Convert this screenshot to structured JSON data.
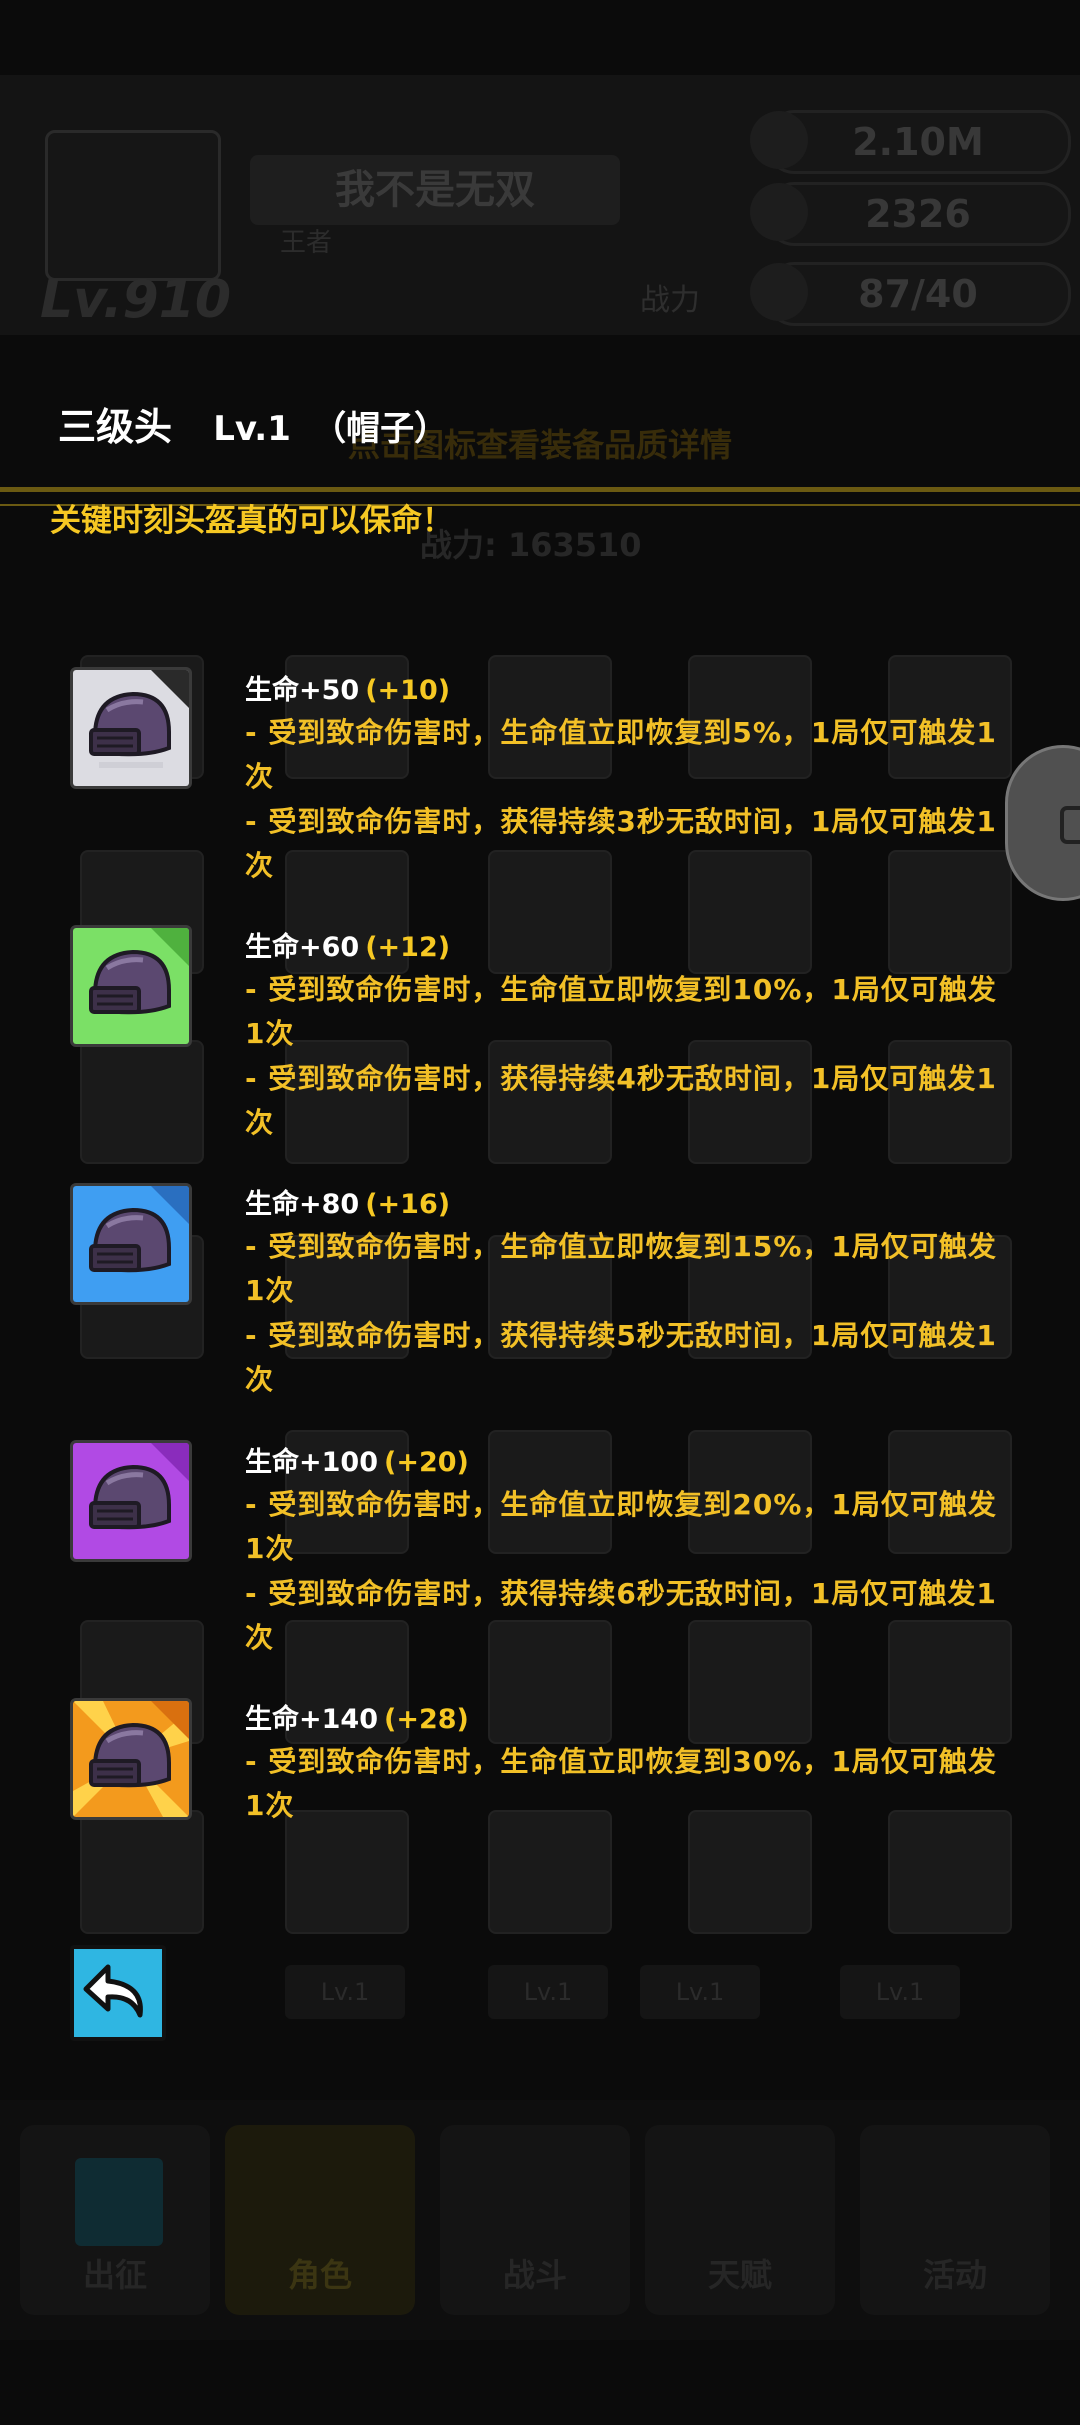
{
  "background": {
    "player_name": "我不是无双",
    "player_subtitle": "王者",
    "player_level": "Lv.910",
    "power_label": "战力",
    "resources": [
      {
        "icon": "gold-coin-icon",
        "value": "2.10M"
      },
      {
        "icon": "diamond-icon",
        "value": "2326"
      },
      {
        "icon": "energy-icon",
        "value": "87/40"
      }
    ],
    "hint": "点击图标查看装备品质详情",
    "score": "战力: 163510",
    "slot_labels": [
      "Lv.1",
      "Lv.1",
      "Lv.1",
      "Lv.1",
      "Lv.1"
    ],
    "nav": [
      "出征",
      "角色",
      "战斗",
      "天赋",
      "活动"
    ]
  },
  "popup": {
    "item_name": "三级头",
    "item_level": "Lv.1",
    "item_type": "（帽子）",
    "tagline": "关键时刻头盔真的可以保命！",
    "tiers": [
      {
        "rarity": "white",
        "color": "#d9d9de",
        "stat": "生命+50",
        "bonus": "(+10)",
        "effects": [
          "- 受到致命伤害时，生命值立即恢复到5%，1局仅可触发1次",
          "- 受到致命伤害时，获得持续3秒无敌时间，1局仅可触发1次"
        ]
      },
      {
        "rarity": "green",
        "color": "#7de36a",
        "stat": "生命+60",
        "bonus": "(+12)",
        "effects": [
          "- 受到致命伤害时，生命值立即恢复到10%，1局仅可触发1次",
          "- 受到致命伤害时，获得持续4秒无敌时间，1局仅可触发1次"
        ]
      },
      {
        "rarity": "blue",
        "color": "#3e9bf0",
        "stat": "生命+80",
        "bonus": "(+16)",
        "effects": [
          "- 受到致命伤害时，生命值立即恢复到15%，1局仅可触发1次",
          "- 受到致命伤害时，获得持续5秒无敌时间，1局仅可触发1次"
        ]
      },
      {
        "rarity": "purple",
        "color": "#b44be6",
        "stat": "生命+100",
        "bonus": "(+20)",
        "effects": [
          "- 受到致命伤害时，生命值立即恢复到20%，1局仅可触发1次",
          "- 受到致命伤害时，获得持续6秒无敌时间，1局仅可触发1次"
        ]
      },
      {
        "rarity": "orange",
        "color": "#f5a524",
        "stat": "生命+140",
        "bonus": "(+28)",
        "effects": [
          "- 受到致命伤害时，生命值立即恢复到30%，1局仅可触发1次"
        ]
      }
    ]
  }
}
